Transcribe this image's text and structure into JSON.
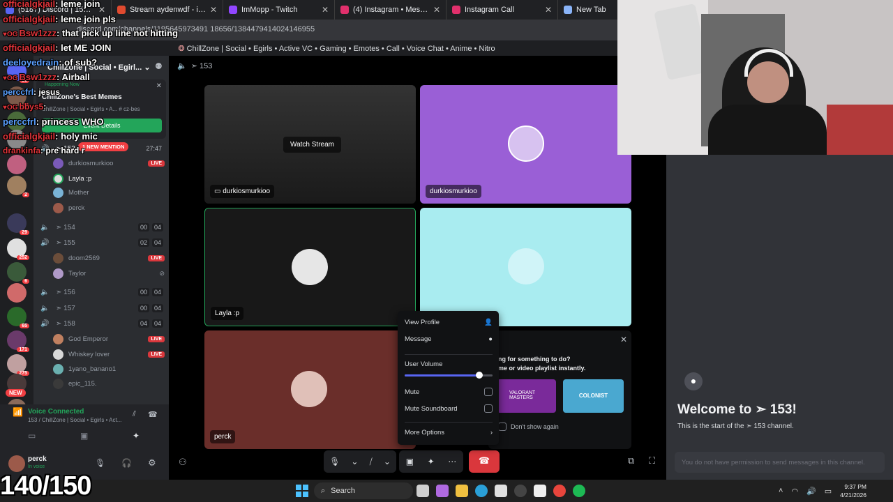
{
  "browser": {
    "tabs": [
      {
        "label": "(5187) Discord | 153 | Ch",
        "color": "#5865f2"
      },
      {
        "label": "Stream aydenwdf - im still ode",
        "color": "#e04a2f"
      },
      {
        "label": "ImMopp - Twitch",
        "color": "#9146ff"
      },
      {
        "label": "(4) Instagram • Messages",
        "color": "#e1306c"
      },
      {
        "label": "Instagram Call",
        "color": "#e1306c"
      },
      {
        "label": "New Tab",
        "color": "#8ab4f8"
      }
    ],
    "url": "discord.com/channels/1195645973491 18656/1384479414024146955",
    "window_title": "ChillZone | Social • Egirls • Active VC • Gaming • Emotes • Call • Voice Chat • Anime • Nitro"
  },
  "server": {
    "name": "ChillZone | Social • Egirl...",
    "happening_label": "Happening Now",
    "event_title": "ChillZone's Best Memes",
    "event_sub": "ChillZone | Social • Egirls • A... # cz-bes",
    "event_button": "Event Details",
    "new_mention": "1 NEW MENTION",
    "new_badge": "NEW",
    "rail_badges": [
      "20",
      "3",
      "2",
      "29",
      "252",
      "6",
      "65",
      "171",
      "275"
    ]
  },
  "channels": [
    {
      "name": "153",
      "count": "27:47",
      "active": true
    },
    {
      "name": "154",
      "count_a": "00",
      "count_b": "04"
    },
    {
      "name": "155",
      "count_a": "02",
      "count_b": "04"
    },
    {
      "name": "156",
      "count_a": "00",
      "count_b": "04"
    },
    {
      "name": "157",
      "count_a": "00",
      "count_b": "04"
    },
    {
      "name": "158",
      "count_a": "04",
      "count_b": "04"
    }
  ],
  "users153": [
    {
      "name": "durkiosmurkioo",
      "live": "LIVE",
      "color": "#7a5ab8"
    },
    {
      "name": "Layla :p",
      "live": "",
      "color": "#ddd"
    },
    {
      "name": "Mother",
      "live": "",
      "color": "#7ab3d6"
    },
    {
      "name": "perck",
      "live": "",
      "color": "#9c5a4a"
    }
  ],
  "users155": [
    {
      "name": "doom2569",
      "live": "LIVE",
      "color": "#6b4d3a"
    },
    {
      "name": "Taylor",
      "live": "",
      "color": "#b09ac8"
    }
  ],
  "users158": [
    {
      "name": "God Emperor",
      "live": "LIVE",
      "color": "#c08060"
    },
    {
      "name": "Whiskey lover",
      "live": "LIVE",
      "color": "#d8d8d8"
    },
    {
      "name": "1yano_banano1",
      "live": "",
      "color": "#6ab0b0"
    },
    {
      "name": "epic_115.",
      "live": "",
      "color": "#3a3a3a"
    }
  ],
  "voice": {
    "status": "Voice Connected",
    "location": "153 / ChillZone | Social • Egirls • Act...",
    "username": "perck",
    "substatus": "In voice"
  },
  "stage": {
    "channel": "153",
    "watch_stream": "Watch Stream",
    "tiles": [
      "durkiosmurkioo",
      "durkiosmurkioo",
      "Layla :p",
      "",
      "perck"
    ]
  },
  "context_menu": {
    "view_profile": "View Profile",
    "message": "Message",
    "user_volume": "User Volume",
    "volume_level": 0.85,
    "mute": "Mute",
    "mute_soundboard": "Mute Soundboard",
    "more_options": "More Options"
  },
  "activity_popup": {
    "line1": "ng for something to do?",
    "line2": "me or video playlist instantly.",
    "dont_show": "Don't show again",
    "card1": "VALORANT MASTERS",
    "card2": "COLONIST"
  },
  "welcome": {
    "title": "Welcome to ➣ 153!",
    "subtitle": "This is the start of the ➣ 153 channel.",
    "input_placeholder": "You do not have permission to send messages in this channel."
  },
  "overlay_chat": [
    {
      "user": "officialgkjail",
      "msg": "leme join",
      "badge": false,
      "color": "red"
    },
    {
      "user": "officialgkjail",
      "msg": "leme join pls",
      "badge": false,
      "color": "red"
    },
    {
      "user": "Bsw1zzz",
      "msg": "that pick up line not hitting",
      "badge": true,
      "color": "red"
    },
    {
      "user": "officialgkjail",
      "msg": "let ME JOIN",
      "badge": false,
      "color": "red"
    },
    {
      "user": "deeloyedrain",
      "msg": "of sub?",
      "badge": false,
      "color": "blue"
    },
    {
      "user": "Bsw1zzz",
      "msg": "Airball",
      "badge": true,
      "color": "red"
    },
    {
      "user": "perccfrl",
      "msg": "jesus",
      "badge": false,
      "color": "blue"
    },
    {
      "user": "bbys5",
      "msg": "",
      "badge": true,
      "color": "red"
    },
    {
      "user": "perccfrl",
      "msg": "princess WHO",
      "badge": false,
      "color": "blue"
    },
    {
      "user": "officialgkjail",
      "msg": "holy mic",
      "badge": false,
      "color": "red"
    },
    {
      "user": "drankinfa",
      "msg": "pre hard r",
      "badge": false,
      "color": "red"
    }
  ],
  "counter": "140/150",
  "taskbar": {
    "search": "Search",
    "time": "9:37 PM",
    "date": "4/21/2026"
  },
  "colors": {
    "accent": "#5865f2",
    "danger": "#da373c",
    "green": "#23a55a"
  }
}
